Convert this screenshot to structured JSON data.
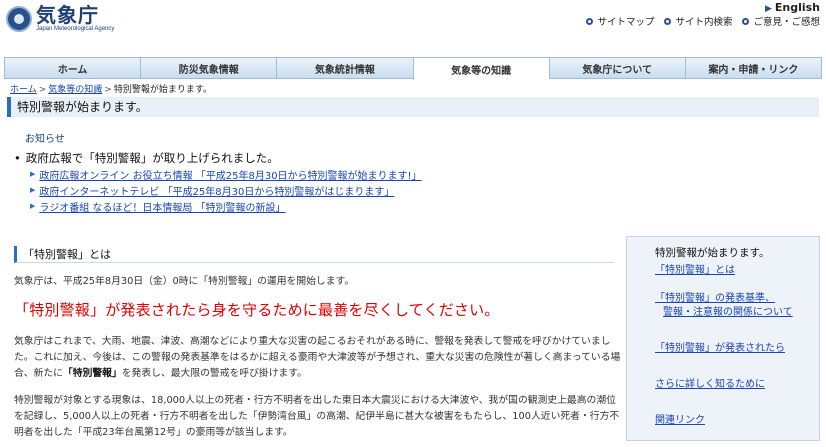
{
  "header": {
    "logo_title": "気象庁",
    "logo_sub": "Japan Meteorological Agency",
    "english": "English",
    "util_links": [
      "サイトマップ",
      "サイト内検索",
      "ご意見・ご感想"
    ]
  },
  "nav": {
    "tabs": [
      "ホーム",
      "防災気象情報",
      "気象統計情報",
      "気象等の知識",
      "気象庁について",
      "案内・申請・リンク"
    ],
    "active": "気象等の知識"
  },
  "breadcrumb": {
    "home": "ホーム",
    "sep": ">",
    "section": "気象等の知識",
    "current": "特別警報が始まります。"
  },
  "page": {
    "title": "特別警報が始まります。",
    "notice_label": "お知らせ",
    "notice_main": "政府広報で「特別警報」が取り上げられました。",
    "notice_links": [
      "政府広報オンライン お役立ち情報 「平成25年8月30日から特別警報が始まります!」",
      "政府インターネットテレビ 「平成25年8月30日から特別警報がはじまります」",
      "ラジオ番組 なるほど！日本情報局 「特別警報の新設」"
    ],
    "section_heading": "「特別警報」とは",
    "p1": "気象庁は、平成25年8月30日（金）0時に「特別警報」の運用を開始します。",
    "headline": "「特別警報」が発表されたら身を守るために最善を尽くしてください。",
    "p2_a": "気象庁はこれまで、大雨、地震、津波、高潮などにより重大な災害の起こるおそれがある時に、警報を発表して警戒を呼びかけていました。これに加え、今後は、この警報の発表基準をはるかに超える豪雨や大津波等が予想され、重大な災害の危険性が著しく高まっている場合、新たに",
    "p2_b": "「特別警報」",
    "p2_c": "を発表し、最大限の警戒を呼び掛けます。",
    "p3": "特別警報が対象とする現象は、18,000人以上の死者・行方不明者を出した東日本大震災における大津波や、我が国の観測史上最高の潮位を記録し、5,000人以上の死者・行方不明者を出した「伊勢湾台風」の高潮、紀伊半島に甚大な被害をもたらし、100人近い死者・行方不明者を出した「平成23年台風第12号」の豪雨等が該当します。"
  },
  "side": {
    "title": "特別警報が始まります。",
    "links": [
      "「特別警報」とは",
      "「特別警報」の発表基準、",
      "警報・注意報の関係について",
      "「特別警報」が発表されたら",
      "さらに詳しく知るために",
      "関連リンク"
    ]
  },
  "colors": {
    "brand": "#1f3f73",
    "accent": "#2a6fbf",
    "link": "#1a44b0",
    "headline": "#e00000"
  }
}
